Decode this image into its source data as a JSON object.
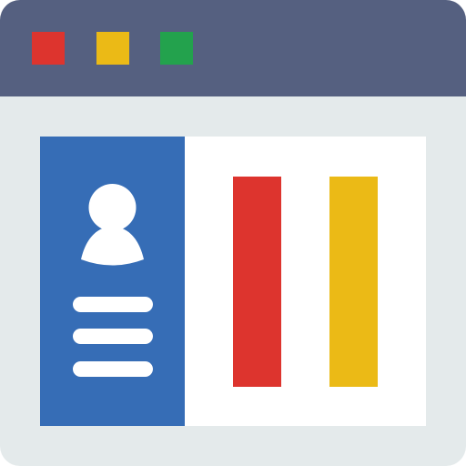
{
  "window": {
    "titlebar_color": "#556080",
    "content_bg_color": "#E4EAEB",
    "buttons": [
      {
        "name": "close",
        "color": "#DD342E"
      },
      {
        "name": "minimize",
        "color": "#EBBA16"
      },
      {
        "name": "maximize",
        "color": "#23A24D"
      }
    ]
  },
  "profile": {
    "panel_color": "#366DB6",
    "avatar_icon": "user-silhouette-icon",
    "info_lines": 3
  },
  "bars": {
    "max_value": 1.0,
    "items": [
      {
        "value": 0.725,
        "color": "#DD342E"
      },
      {
        "value": 0.725,
        "color": "#EBBA16"
      }
    ]
  }
}
